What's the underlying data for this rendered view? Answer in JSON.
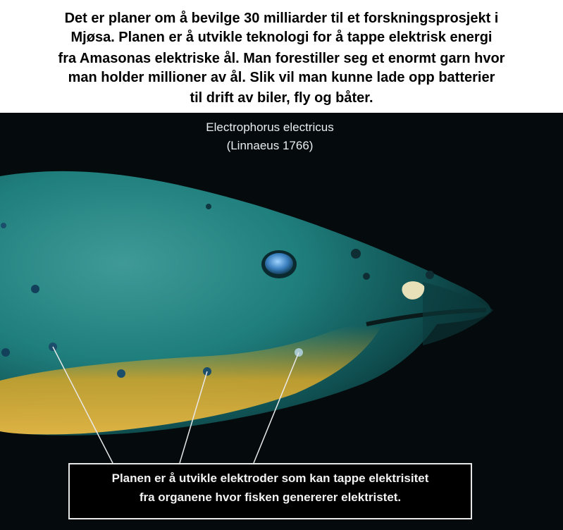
{
  "caption": {
    "lines": [
      "Det er planer om å bevilge 30 milliarder til et forskningsprosjekt i",
      "Mjøsa. Planen er å utvikle teknologi for å tappe elektrisk energi",
      "fra Amasonas elektriske ål. Man forestiller seg et enormt garn hvor",
      "man holder millioner av ål. Slik vil man kunne lade opp batterier",
      "til drift av biler, fly og båter."
    ]
  },
  "photo": {
    "species_name": "Electrophorus electricus",
    "species_author": "(Linnaeus 1766)",
    "callout_lines": [
      "Planen er å utvikle elektroder som kan tappe elektrisitet",
      "fra organene hvor fisken genererer elektristet."
    ]
  }
}
